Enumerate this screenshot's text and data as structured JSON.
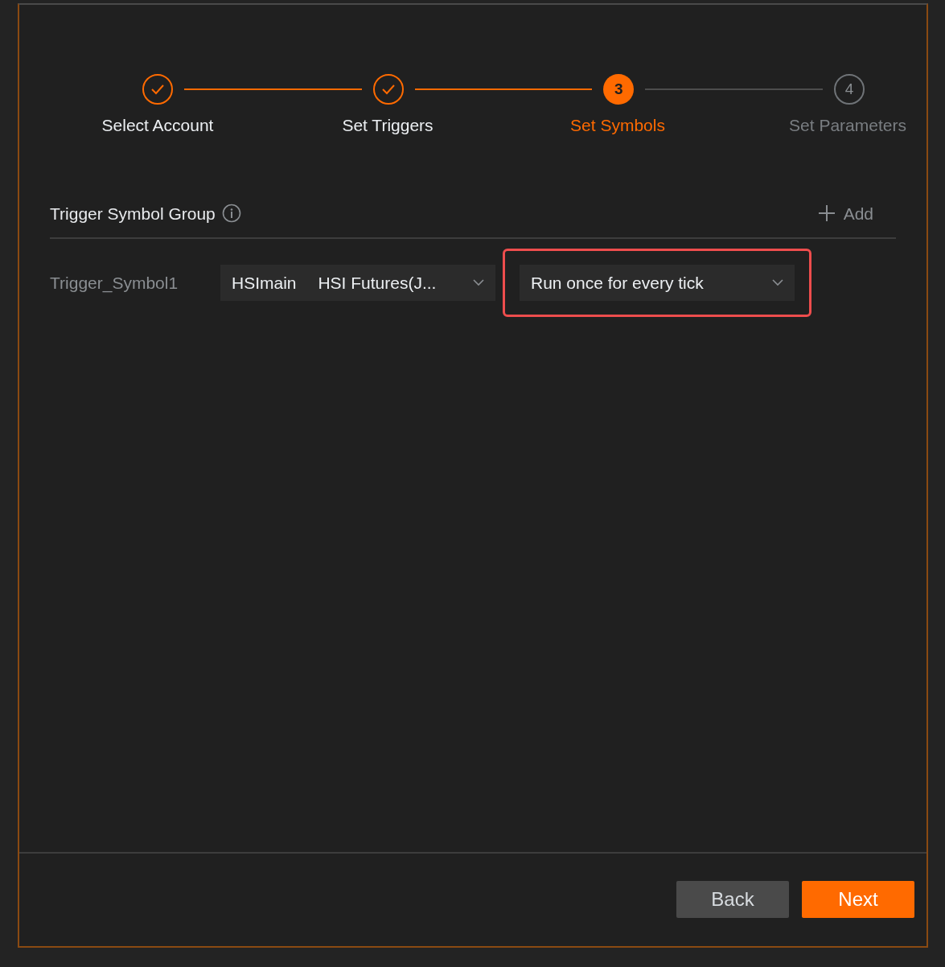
{
  "steps": [
    {
      "label": "Select Account",
      "completed": true,
      "selected": false
    },
    {
      "label": "Set Triggers",
      "completed": true,
      "selected": false
    },
    {
      "label": "Set Symbols",
      "number": "3",
      "completed": false,
      "selected": true
    },
    {
      "label": "Set Parameters",
      "number": "4",
      "completed": false,
      "selected": false
    }
  ],
  "section": {
    "title": "Trigger Symbol Group",
    "add_label": "Add"
  },
  "symbol_rows": [
    {
      "label": "Trigger_Symbol1",
      "symbol": {
        "code": "HSImain",
        "name": "HSI Futures(J..."
      },
      "mode": {
        "value": "Run once for every tick",
        "highlighted": true
      }
    }
  ],
  "buttons": [
    {
      "label": "Back",
      "kind": "secondary"
    },
    {
      "label": "Next",
      "kind": "primary"
    }
  ]
}
